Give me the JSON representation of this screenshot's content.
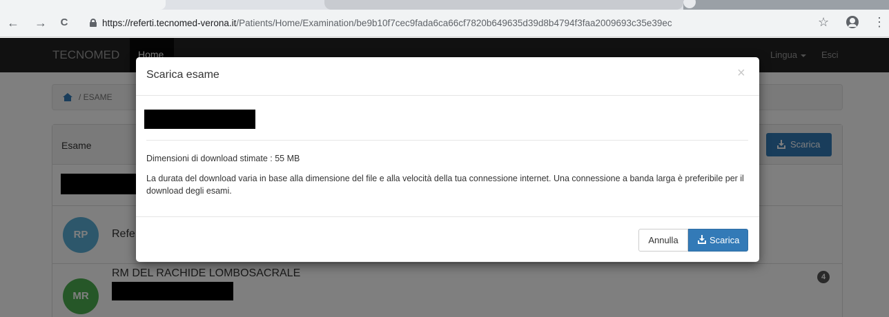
{
  "browser": {
    "url_host": "https://referti.tecnomed-verona.it",
    "url_path": "/Patients/Home/Examination/be9b10f7cec9fada6ca66cf7820b649635d39d8b4794f3faa2009693c35e39ec",
    "back_glyph": "←",
    "forward_glyph": "→",
    "reload_glyph": "C",
    "star_glyph": "☆",
    "menu_glyph": "⋮"
  },
  "navbar": {
    "brand": "TECNOMED",
    "home": "Home",
    "lingua": "Lingua",
    "esci": "Esci"
  },
  "breadcrumb": {
    "current": "/ ESAME"
  },
  "panel": {
    "title": "Esame",
    "download_button": "Scarica",
    "items": [
      {
        "initials": "RP",
        "title": "Refe",
        "color": "#5aafd7"
      },
      {
        "initials": "MR",
        "title": "RM DEL RACHIDE LOMBOSACRALE",
        "color": "#4caf50",
        "badge": "4"
      }
    ]
  },
  "modal": {
    "title": "Scarica esame",
    "close": "×",
    "size_label": "Dimensioni di download stimate : 55 MB",
    "description": "La durata del download varia in base alla dimensione del file e alla velocità della tua connessione internet. Una connessione a banda larga è preferibile per il download degli esami.",
    "cancel_button": "Annulla",
    "download_button": "Scarica"
  },
  "colors": {
    "primary": "#337ab7",
    "navbar": "#222222"
  }
}
